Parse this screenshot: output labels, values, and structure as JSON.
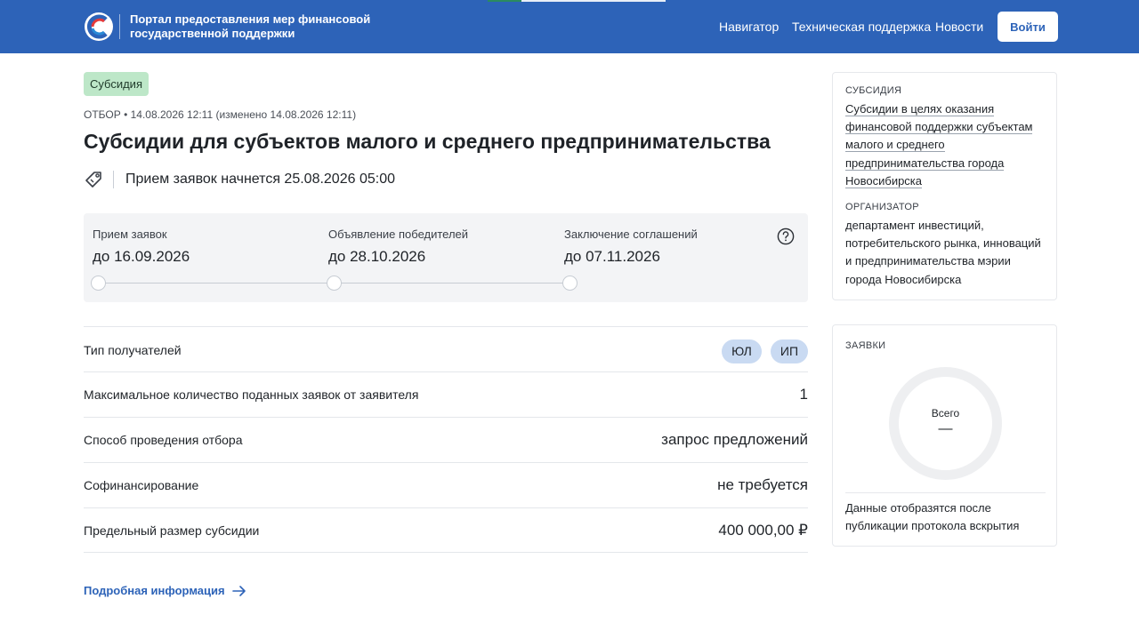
{
  "header": {
    "portal_name": "Портал предоставления мер финансовой государственной поддержки",
    "nav": [
      "Навигатор",
      "Техническая поддержка",
      "Новости"
    ],
    "login_label": "Войти",
    "brand_color": "#2d63b8"
  },
  "main": {
    "badge": "Субсидия",
    "meta": "ОТБОР • 14.08.2026 12:11 (изменено 14.08.2026 12:11)",
    "title": "Субсидии для субъектов малого и среднего предпринимательства",
    "tag_icon": "tag-icon",
    "start_text": "Прием заявок начнется 25.08.2026 05:00",
    "timeline": [
      {
        "label": "Прием заявок",
        "date": "до 16.09.2026"
      },
      {
        "label": "Объявление победителей",
        "date": "до 28.10.2026"
      },
      {
        "label": "Заключение соглашений",
        "date": "до 07.11.2026"
      }
    ],
    "help_icon": "question-circle-icon",
    "rows": {
      "recipients": {
        "label": "Тип получателей",
        "chips": [
          "ЮЛ",
          "ИП"
        ]
      },
      "max_apps": {
        "label": "Максимальное количество поданных заявок от заявителя",
        "value": "1"
      },
      "method": {
        "label": "Способ проведения отбора",
        "value": "запрос предложений"
      },
      "cofinancing": {
        "label": "Софинансирование",
        "value": "не требуется"
      },
      "limit": {
        "label": "Предельный размер субсидии",
        "value": "400 000,00 ₽"
      }
    },
    "more_link": "Подробная информация",
    "more_icon": "arrow-right-icon"
  },
  "sidebar": {
    "subsidy_caption": "СУБСИДИЯ",
    "subsidy_lines": [
      "Субсидии в целях оказания",
      "финансовой поддержки субъектам",
      "малого и среднего",
      "предпринимательства города",
      "Новосибирска"
    ],
    "organizer_caption": "ОРГАНИЗАТОР",
    "organizer": "департамент инвестиций, потребительского рынка, инноваций и предпринимательства мэрии города Новосибирска",
    "apps_caption": "ЗАЯВКИ",
    "donut_label": "Всего",
    "donut_value": "—",
    "note": "Данные отобразятся после публикации протокола вскрытия"
  }
}
